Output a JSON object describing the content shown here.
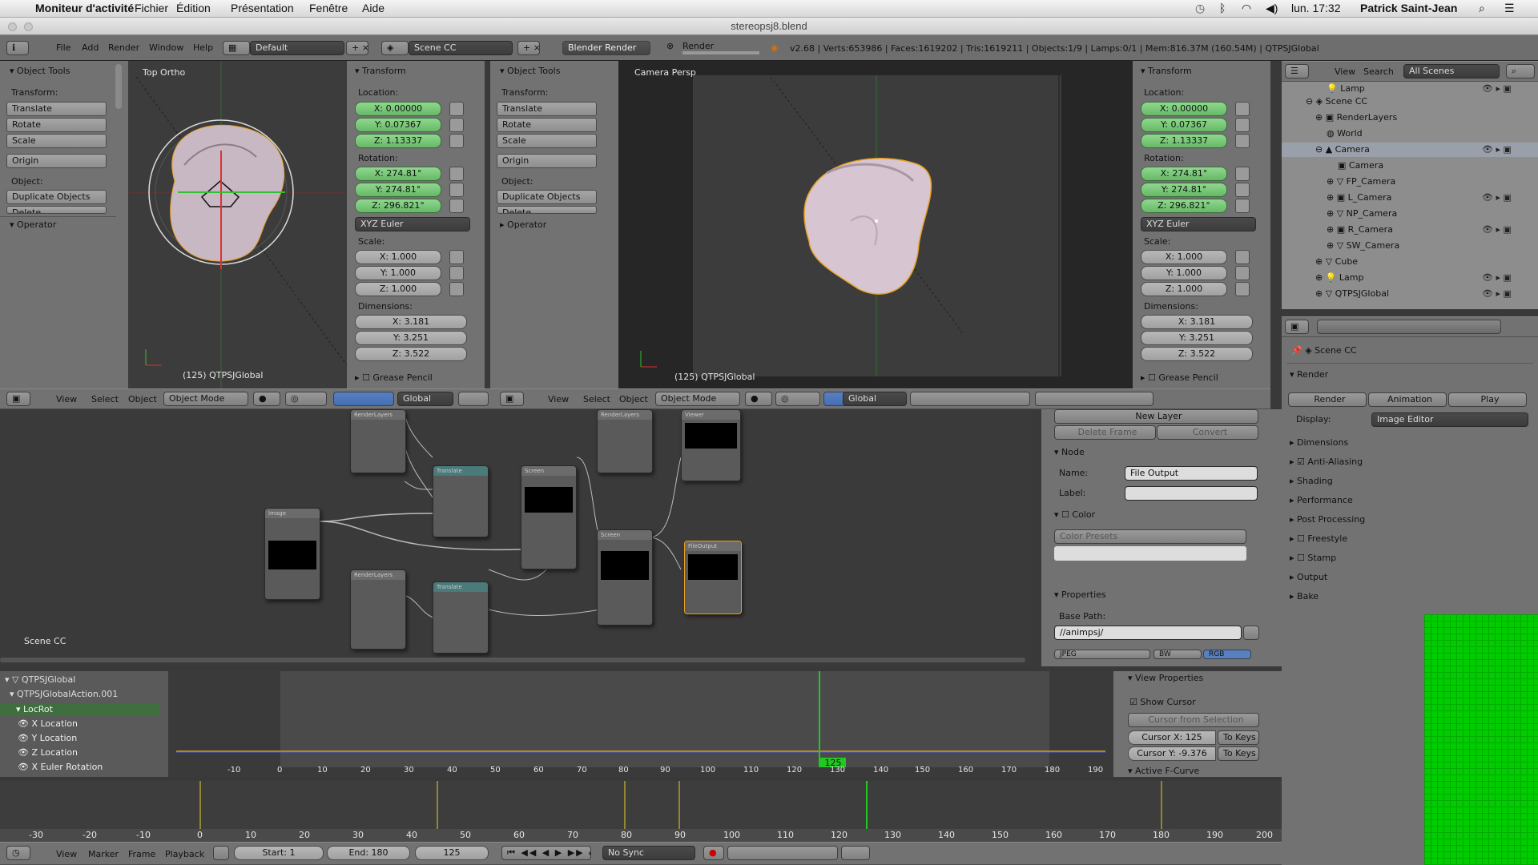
{
  "menubar": {
    "app": "Moniteur d'activité",
    "items": [
      "Fichier",
      "Édition",
      "Présentation",
      "Fenêtre",
      "Aide"
    ],
    "clock": "lun. 17:32",
    "user": "Patrick Saint-Jean"
  },
  "window_title": "stereopsj8.blend",
  "infobar": {
    "menus": [
      "File",
      "Add",
      "Render",
      "Window",
      "Help"
    ],
    "layout": "Default",
    "scene": "Scene CC",
    "engine": "Blender Render",
    "render_label": "Render",
    "stats": "v2.68 | Verts:653986 | Faces:1619202 | Tris:1619211 | Objects:1/9 | Lamps:0/1 | Mem:816.37M (160.54M) | QTPSJGlobal"
  },
  "tool_shelf": {
    "title": "Object Tools",
    "transform_label": "Transform:",
    "buttons": [
      "Translate",
      "Rotate",
      "Scale"
    ],
    "origin": "Origin",
    "object_label": "Object:",
    "object_buttons": [
      "Duplicate Objects",
      "Delete"
    ],
    "operator": "Operator"
  },
  "viewport_left": {
    "label": "Top Ortho",
    "footer": "(125) QTPSJGlobal"
  },
  "viewport_right": {
    "label": "Camera Persp",
    "footer": "(125) QTPSJGlobal"
  },
  "transform_panel": {
    "title": "Transform",
    "location_label": "Location:",
    "location": [
      "X: 0.00000",
      "Y: 0.07367",
      "Z: 1.13337"
    ],
    "rotation_label": "Rotation:",
    "rotation": [
      "X: 274.81°",
      "Y: 274.81°",
      "Z: 296.821°"
    ],
    "rotation_mode": "XYZ Euler",
    "scale_label": "Scale:",
    "scale": [
      "X: 1.000",
      "Y: 1.000",
      "Z: 1.000"
    ],
    "dimensions_label": "Dimensions:",
    "dimensions": [
      "X: 3.181",
      "Y: 3.251",
      "Z: 3.522"
    ],
    "grease_pencil": "Grease Pencil"
  },
  "view3d_header": {
    "menus": [
      "View",
      "Select",
      "Object"
    ],
    "mode": "Object Mode",
    "orientation": "Global"
  },
  "outliner": {
    "header": {
      "view": "View",
      "search": "Search",
      "filter": "All Scenes"
    },
    "items": [
      "Lamp",
      "Scene CC",
      "RenderLayers",
      "World",
      "Camera",
      "Camera",
      "FP_Camera",
      "L_Camera",
      "NP_Camera",
      "R_Camera",
      "SW_Camera",
      "Cube",
      "Lamp",
      "QTPSJGlobal"
    ]
  },
  "properties": {
    "scene": "Scene CC",
    "render_title": "Render",
    "buttons": [
      "Render",
      "Animation",
      "Play"
    ],
    "display_label": "Display:",
    "display_value": "Image Editor",
    "sections": [
      "Dimensions",
      "Anti-Aliasing",
      "Shading",
      "Performance",
      "Post Processing",
      "Freestyle",
      "Stamp",
      "Output",
      "Bake"
    ]
  },
  "node_editor": {
    "scene_label": "Scene CC",
    "sidebar": {
      "new_layer": "New Layer",
      "delete_frame": "Delete Frame",
      "convert": "Convert",
      "node_title": "Node",
      "name_label": "Name:",
      "name_value": "File Output",
      "label_label": "Label:",
      "color_title": "Color",
      "color_presets": "Color Presets",
      "properties_title": "Properties",
      "base_path_label": "Base Path:",
      "base_path_value": "//animpsj/",
      "format": "JPEG",
      "bw": "BW",
      "rgb": "RGB"
    }
  },
  "dopesheet": {
    "channels": [
      "QTPSJGlobal",
      "QTPSJGlobalAction.001",
      "LocRot",
      "X Location",
      "Y Location",
      "Z Location",
      "X Euler Rotation"
    ],
    "ticks": [
      "-10",
      "0",
      "10",
      "20",
      "30",
      "40",
      "50",
      "60",
      "70",
      "80",
      "90",
      "100",
      "110",
      "120",
      "130",
      "140",
      "150",
      "160",
      "170",
      "180",
      "190"
    ],
    "current_frame": "125",
    "view_properties": "View Properties",
    "show_cursor": "Show Cursor",
    "cursor_from_selection": "Cursor from Selection",
    "cursor_x": "Cursor X: 125",
    "cursor_y": "Cursor Y: -9.376",
    "to_keys": "To Keys",
    "active_fcurve": "Active F-Curve"
  },
  "timeline": {
    "ticks": [
      "-30",
      "-20",
      "-10",
      "0",
      "10",
      "20",
      "30",
      "40",
      "50",
      "60",
      "70",
      "80",
      "90",
      "100",
      "110",
      "120",
      "130",
      "140",
      "150",
      "160",
      "170",
      "180",
      "190",
      "200"
    ],
    "menus": [
      "View",
      "Marker",
      "Frame",
      "Playback"
    ],
    "start": "Start: 1",
    "end": "End: 180",
    "frame": "125",
    "sync": "No Sync"
  },
  "colors": {
    "accent_green": "#6cc46c",
    "selection_blue": "#5680c2",
    "keyframe_orange": "#e8a020",
    "frame_green": "#22c722"
  }
}
